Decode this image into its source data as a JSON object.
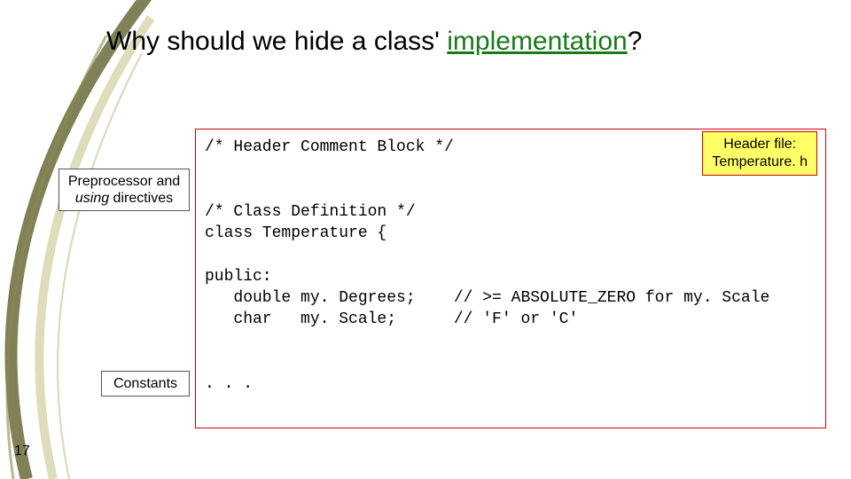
{
  "title": {
    "prefix": "Why should we hide a class' ",
    "highlight": "implementation",
    "suffix": "?"
  },
  "code": {
    "line1": "/* Header Comment Block */",
    "line2": "",
    "line3": "",
    "line4": "/* Class Definition */",
    "line5": "class Temperature {",
    "line6": "",
    "line7": "public:",
    "line8": "   double my. Degrees;    // >= ABSOLUTE_ZERO for my. Scale",
    "line9": "   char   my. Scale;      // 'F' or 'C'",
    "line10": "",
    "line11": "",
    "line12": ". . ."
  },
  "labels": {
    "preproc_line1": "Preprocessor and",
    "preproc_line2_prefix": "using",
    "preproc_line2_suffix": " directives",
    "constants": "Constants"
  },
  "header_file": {
    "line1": "Header file:",
    "line2": "Temperature. h"
  },
  "slide_number": "17"
}
